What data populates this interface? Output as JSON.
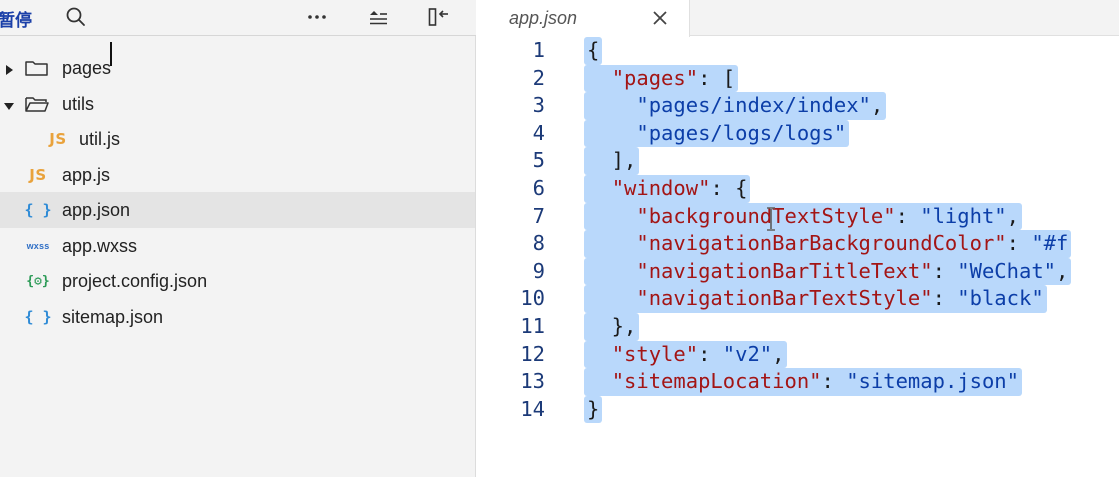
{
  "explorer": {
    "title": "暂停",
    "icons": [
      "search-icon",
      "more-icon",
      "collapse-icon",
      "split-icon"
    ],
    "items": [
      {
        "label": "pages",
        "type": "folder",
        "expanded": false,
        "depth": 0
      },
      {
        "label": "utils",
        "type": "folder",
        "expanded": true,
        "depth": 0
      },
      {
        "label": "util.js",
        "type": "js",
        "icon_text": "JS",
        "depth": 1
      },
      {
        "label": "app.js",
        "type": "js",
        "icon_text": "JS",
        "depth": 0
      },
      {
        "label": "app.json",
        "type": "json",
        "icon_text": "{ }",
        "depth": 0,
        "selected": true
      },
      {
        "label": "app.wxss",
        "type": "wxss",
        "icon_text": "wxss",
        "depth": 0
      },
      {
        "label": "project.config.json",
        "type": "config",
        "icon_text": "{⚙}",
        "depth": 0
      },
      {
        "label": "sitemap.json",
        "type": "json",
        "icon_text": "{ }",
        "depth": 0
      }
    ]
  },
  "editor": {
    "tab_label": "app.json",
    "line_numbers": [
      "1",
      "2",
      "3",
      "4",
      "5",
      "6",
      "7",
      "8",
      "9",
      "10",
      "11",
      "12",
      "13",
      "14"
    ],
    "lines": [
      "{",
      "  \"pages\": [",
      "    \"pages/index/index\",",
      "    \"pages/logs/logs\"",
      "  ],",
      "  \"window\": {",
      "    \"backgroundTextStyle\": \"light\",",
      "    \"navigationBarBackgroundColor\": \"#f",
      "    \"navigationBarTitleText\": \"WeChat\",",
      "    \"navigationBarTextStyle\": \"black\"",
      "  },",
      "  \"style\": \"v2\",",
      "  \"sitemapLocation\": \"sitemap.json\"",
      "}"
    ]
  },
  "colors": {
    "selection": "#b9d8fb",
    "key": "#a31515",
    "string": "#0c3ea8",
    "line_number": "#1c3a78",
    "js_icon": "#e9a23b",
    "json_icon": "#2f8bd6",
    "config_icon": "#2b9a56"
  }
}
